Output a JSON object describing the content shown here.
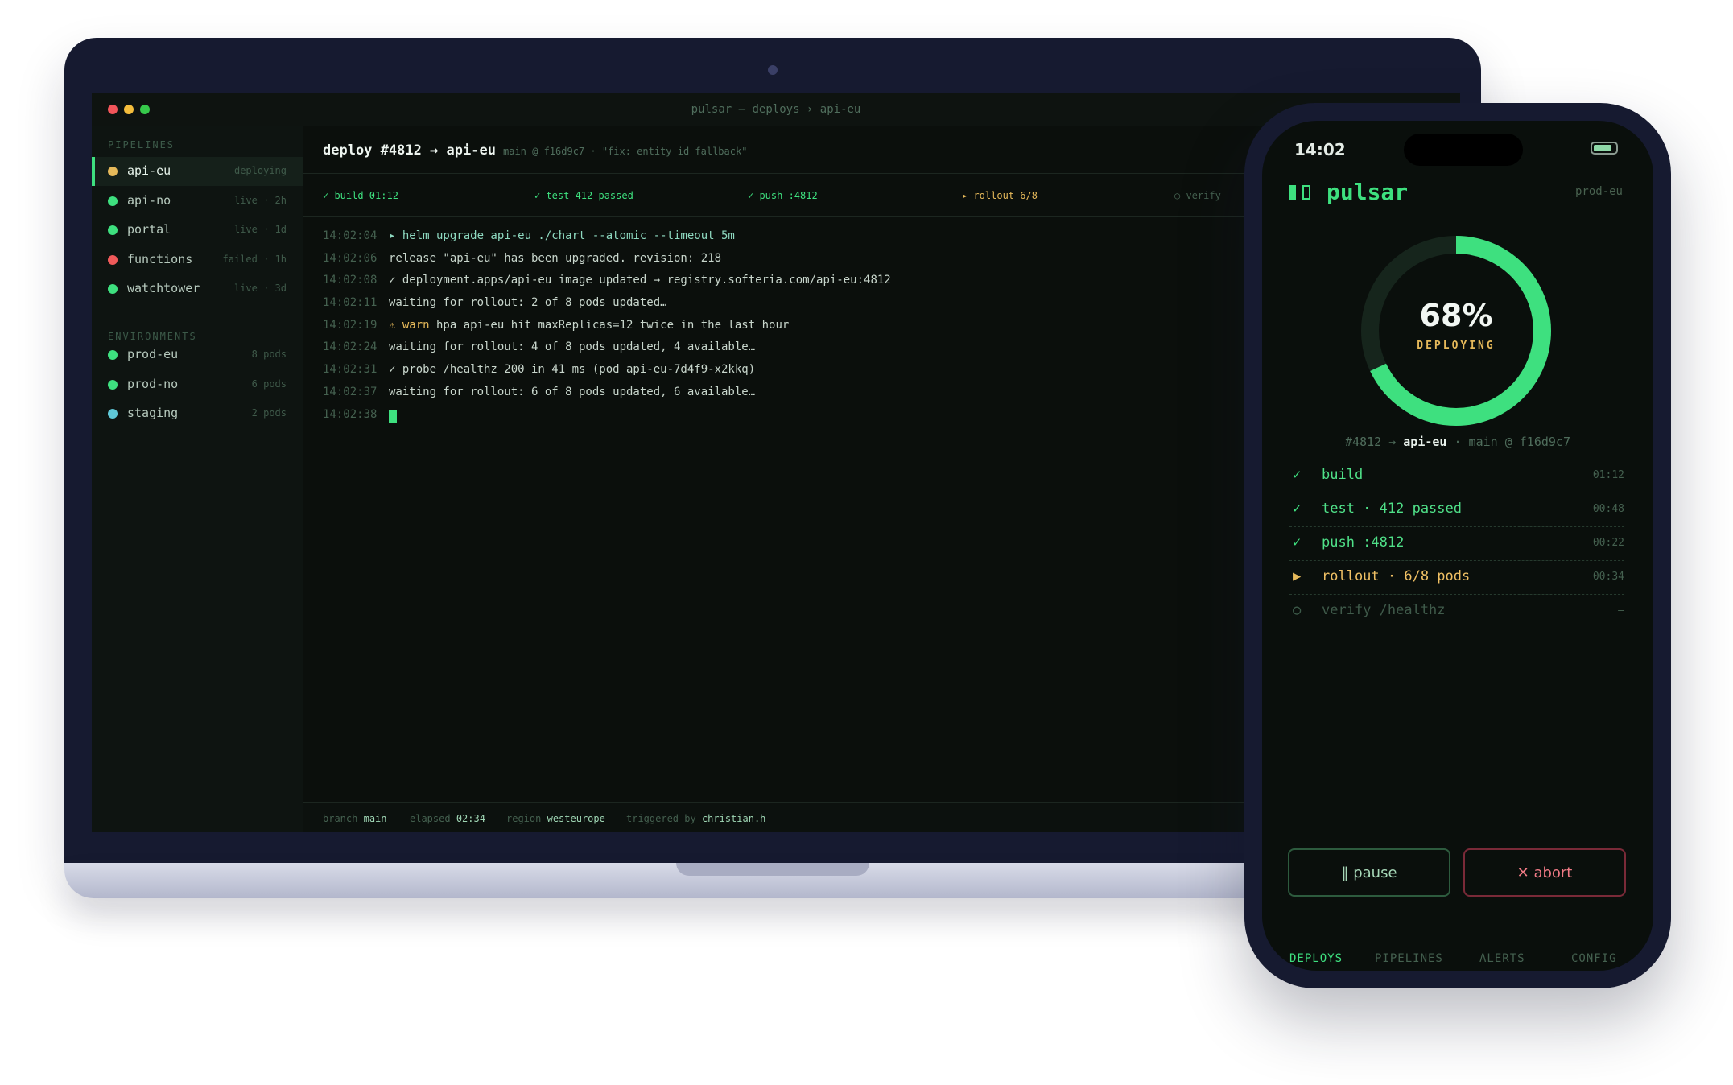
{
  "window": {
    "title": "pulsar — deploys › api-eu"
  },
  "sidebar": {
    "pipelines_title": "PIPELINES",
    "pipelines": [
      {
        "name": "api-eu",
        "meta": "deploying",
        "color": "#e6b95a"
      },
      {
        "name": "api-no",
        "meta": "live · 2h",
        "color": "#3ee07f"
      },
      {
        "name": "portal",
        "meta": "live · 1d",
        "color": "#3ee07f"
      },
      {
        "name": "functions",
        "meta": "failed · 1h",
        "color": "#f05a5a"
      },
      {
        "name": "watchtower",
        "meta": "live · 3d",
        "color": "#3ee07f"
      }
    ],
    "environments_title": "ENVIRONMENTS",
    "environments": [
      {
        "name": "prod-eu",
        "meta": "8 pods",
        "color": "#3ee07f"
      },
      {
        "name": "prod-no",
        "meta": "6 pods",
        "color": "#3ee07f"
      },
      {
        "name": "staging",
        "meta": "2 pods",
        "color": "#5fc8d8"
      }
    ]
  },
  "deploy": {
    "title": "deploy #4812 → api-eu",
    "subtitle": "main @ f16d9c7 · \"fix: entity id fallback\"",
    "stages": [
      {
        "label": "✓ build 01:12",
        "state": "done"
      },
      {
        "label": "✓ test 412 passed",
        "state": "done"
      },
      {
        "label": "✓ push :4812",
        "state": "done"
      },
      {
        "label": "▸ rollout 6/8",
        "state": "active"
      },
      {
        "label": "○ verify",
        "state": "pending"
      }
    ]
  },
  "log": [
    {
      "time": "14:02:04",
      "msg": "▸ helm upgrade api-eu ./chart --atomic --timeout 5m",
      "kind": "cmd"
    },
    {
      "time": "14:02:06",
      "msg": "release \"api-eu\" has been upgraded. revision: 218",
      "kind": "info"
    },
    {
      "time": "14:02:08",
      "msg": "✓ deployment.apps/api-eu image updated → registry.softeria.com/api-eu:4812",
      "kind": "ok"
    },
    {
      "time": "14:02:11",
      "msg": "waiting for rollout: 2 of 8 pods updated…",
      "kind": "info"
    },
    {
      "time": "14:02:19",
      "warn_tag": "⚠ warn",
      "msg": " hpa api-eu hit maxReplicas=12 twice in the last hour",
      "kind": "warn"
    },
    {
      "time": "14:02:24",
      "msg": "waiting for rollout: 4 of 8 pods updated, 4 available…",
      "kind": "info"
    },
    {
      "time": "14:02:31",
      "msg": "✓ probe /healthz 200 in 41 ms (pod api-eu-7d4f9-x2kkq)",
      "kind": "ok"
    },
    {
      "time": "14:02:37",
      "msg": "waiting for rollout: 6 of 8 pods updated, 6 available…",
      "kind": "info"
    },
    {
      "time": "14:02:38",
      "msg": "",
      "kind": "cursor"
    }
  ],
  "status": {
    "branch_label": "branch",
    "branch": "main",
    "elapsed_label": "elapsed",
    "elapsed": "02:34",
    "region_label": "region",
    "region": "westeurope",
    "trigger_label": "triggered by",
    "trigger": "christian.h"
  },
  "phone": {
    "time": "14:02",
    "battery_level": 0.85,
    "brand": "pulsar",
    "region": "prod-eu",
    "progress_percent": 68,
    "progress_text": "68%",
    "progress_label": "DEPLOYING",
    "build_id": "#4812 →",
    "build_target": "api-eu",
    "build_ref": "· main @ f16d9c7",
    "stages": [
      {
        "icon": "✓",
        "label": "build",
        "duration": "01:12",
        "state": "done"
      },
      {
        "icon": "✓",
        "label": "test · 412 passed",
        "duration": "00:48",
        "state": "done"
      },
      {
        "icon": "✓",
        "label": "push :4812",
        "duration": "00:22",
        "state": "done"
      },
      {
        "icon": "▶",
        "label": "rollout · 6/8 pods",
        "duration": "00:34",
        "state": "active"
      },
      {
        "icon": "○",
        "label": "verify /healthz",
        "duration": "–",
        "state": "pending"
      }
    ],
    "pause_label": "pause",
    "abort_label": "abort",
    "tabs": [
      "DEPLOYS",
      "PIPELINES",
      "ALERTS",
      "CONFIG"
    ]
  },
  "colors": {
    "accent": "#3ee07f",
    "warning": "#e6b95a",
    "danger": "#f05a5a",
    "muted": "#44604f"
  }
}
